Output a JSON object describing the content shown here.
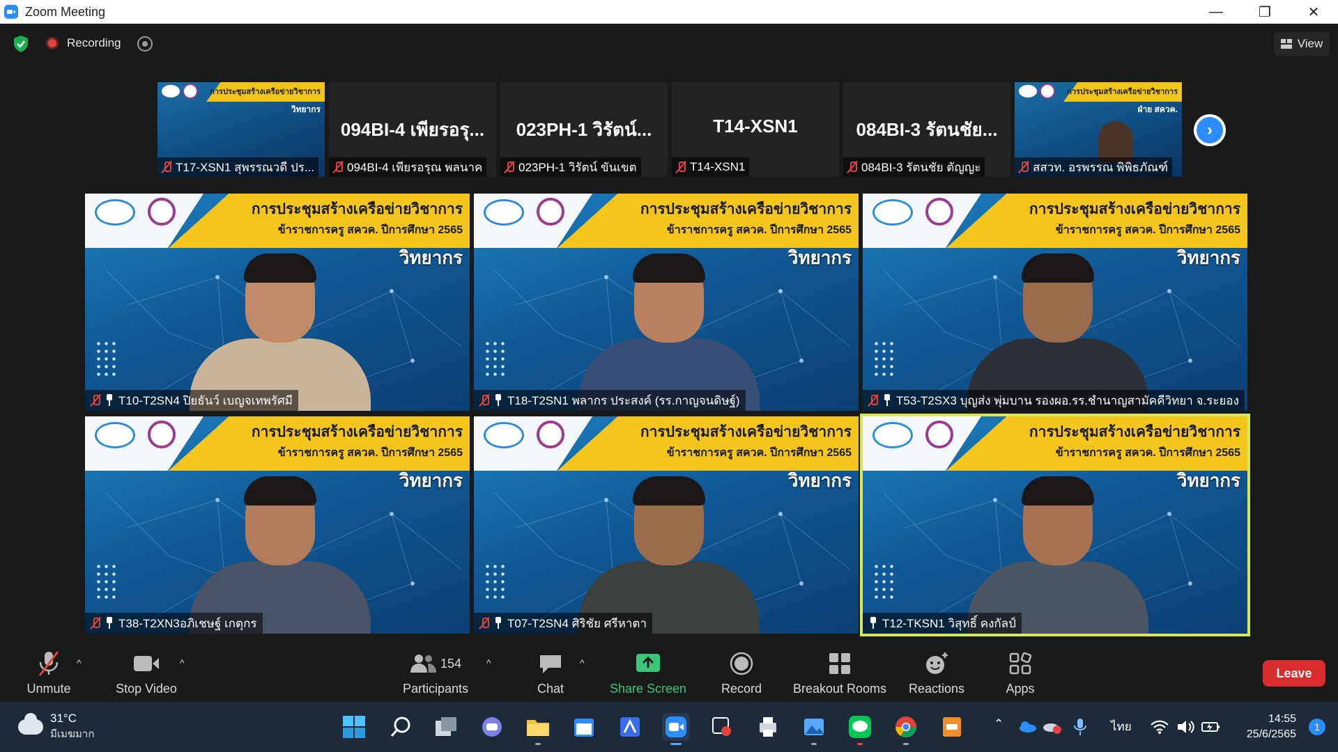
{
  "window": {
    "title": "Zoom Meeting",
    "controls": [
      "—",
      "❐",
      "✕"
    ]
  },
  "topbar": {
    "recording_label": "Recording",
    "view_label": "View"
  },
  "thumbnails": [
    {
      "kind": "slide",
      "header": "การประชุมสร้างเครือข่ายวิชาการ",
      "sub": "วิทยากร",
      "caption": "T17-XSN1 สุพรรณวดี ปร..."
    },
    {
      "kind": "name",
      "big": "094BI-4 เพียรอรุ...",
      "caption": "094BI-4 เพียรอรุณ พลนาค"
    },
    {
      "kind": "name",
      "big": "023PH-1 วิรัตน์...",
      "caption": "023PH-1 วิรัตน์ ขันเขต"
    },
    {
      "kind": "name",
      "big": "T14-XSN1",
      "caption": "T14-XSN1"
    },
    {
      "kind": "name",
      "big": "084BI-3 รัตนชัย...",
      "caption": "084BI-3 รัตนชัย ตัญญะ"
    },
    {
      "kind": "slide-person",
      "header": "การประชุมสร้างเครือข่ายวิชาการ",
      "sub": "ฝ่าย สควค.",
      "caption": "สสวท. อรพรรณ พิพิธภัณฑ์"
    }
  ],
  "slide_text": {
    "line1": "การประชุมสร้างเครือข่ายวิชาการ",
    "line2": "ข้าราชการครู สควค. ปีการศึกษา 2565",
    "line3": "วิทยากร"
  },
  "tiles": [
    {
      "name": "T10-T2SN4 ปิยธันว์ เบญจเทพรัศมี",
      "muted": true,
      "active": false,
      "skin": "#c08a66",
      "suit": "#c9b49a"
    },
    {
      "name": "T18-T2SN1 พลากร ประสงค์ (รร.กาญจนดิษฐ์)",
      "muted": true,
      "active": false,
      "skin": "#b98060",
      "suit": "#3a4f78"
    },
    {
      "name": "T53-T2SX3 บุญส่ง พุ่มบาน รองผอ.รร.ชำนาญสามัคคีวิทยา จ.ระยอง",
      "muted": true,
      "active": false,
      "skin": "#9c6a4c",
      "suit": "#2b2f38"
    },
    {
      "name": "T38-T2XN3อภิเชษฐ์ เกตุกร",
      "muted": true,
      "active": false,
      "skin": "#b27b5a",
      "suit": "#4a5468"
    },
    {
      "name": "T07-T2SN4 ศิริชัย ศรีหาตา",
      "muted": true,
      "active": false,
      "skin": "#9d6c4e",
      "suit": "#3b3f3e"
    },
    {
      "name": "T12-TKSN1 วิสุทธิ์ คงกัลป์",
      "muted": false,
      "active": true,
      "skin": "#a8714f",
      "suit": "#4b5563"
    }
  ],
  "toolbar": {
    "unmute": "Unmute",
    "stop_video": "Stop Video",
    "participants_count": "154",
    "participants": "Participants",
    "chat": "Chat",
    "share_screen": "Share Screen",
    "record": "Record",
    "breakout_rooms": "Breakout Rooms",
    "reactions": "Reactions",
    "apps": "Apps",
    "leave": "Leave"
  },
  "taskbar": {
    "temp": "31°C",
    "weather_desc": "มีเมฆมาก",
    "language": "ไทย",
    "time": "14:55",
    "date": "25/6/2565",
    "notifications": "1"
  },
  "colors": {
    "zoom_blue": "#2d8cff",
    "record_red": "#e0443e",
    "share_green": "#39c57a",
    "active_speaker": "#d9e85a",
    "leave_red": "#d92d2d"
  }
}
